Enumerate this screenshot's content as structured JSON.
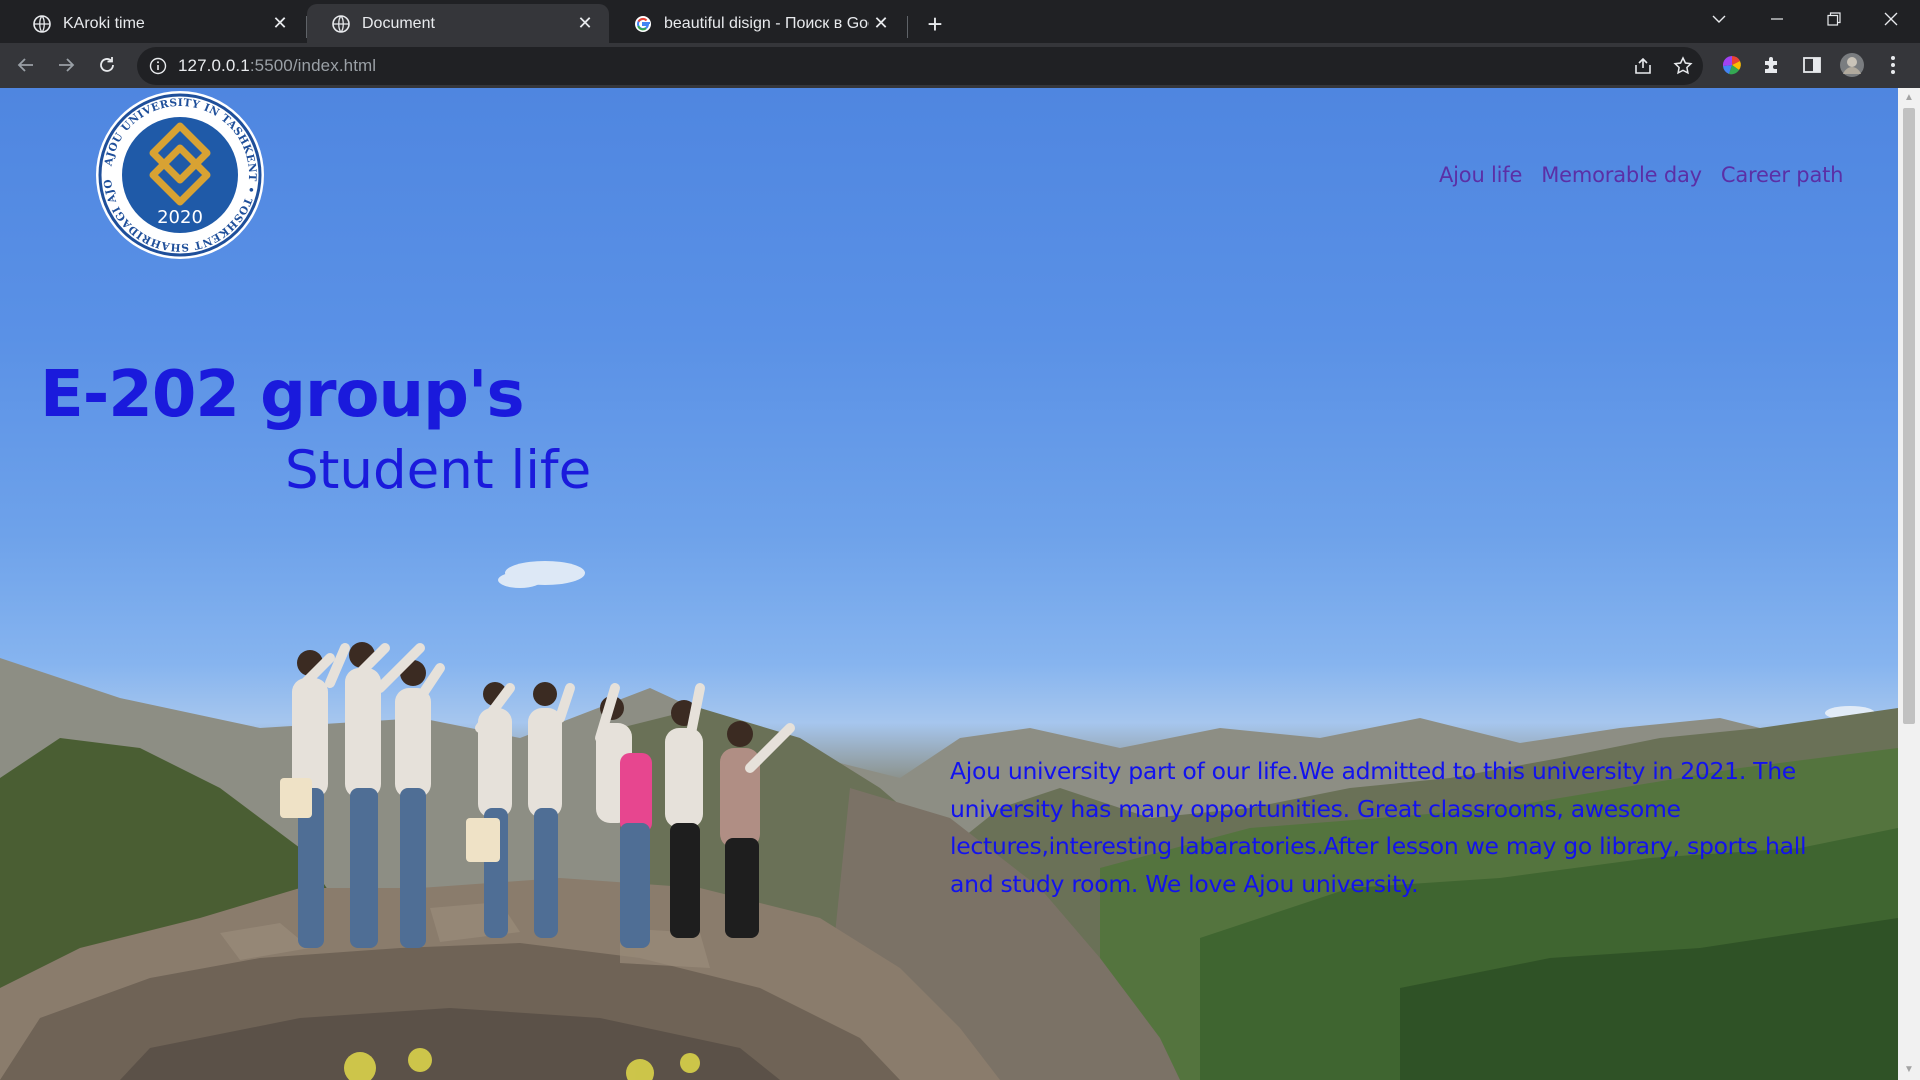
{
  "browser": {
    "tabs": [
      {
        "title": "KAroki time",
        "active": false
      },
      {
        "title": "Document",
        "active": true
      },
      {
        "title": "beautiful disign - Поиск в Google",
        "active": false
      }
    ],
    "url_host": "127.0.0.1",
    "url_rest": ":5500/index.html",
    "colors": {
      "frame": "#202124",
      "toolbar": "#35363a",
      "text": "#e8eaed"
    }
  },
  "page": {
    "logo": {
      "ring_text": "AJOU UNIVERSITY IN TASHKENT • TOSHKENT SHAHRIDAGI AJOU UNIVERSITETI",
      "year": "2020"
    },
    "nav": [
      "Ajou life",
      "Memorable day",
      "Career path"
    ],
    "heading": "E-202 group's",
    "subheading": "Student life",
    "paragraph": "Ajou university part of our life.We admitted to this university in 2021. The university has many opportunities. Great classrooms, awesome lectures,interesting labaratories.After lesson we may go library, sports hall and study room. We love Ajou university.",
    "colors": {
      "heading": "#1a1adc",
      "nav": "#5b2fa6",
      "paragraph": "#1212ee"
    }
  }
}
